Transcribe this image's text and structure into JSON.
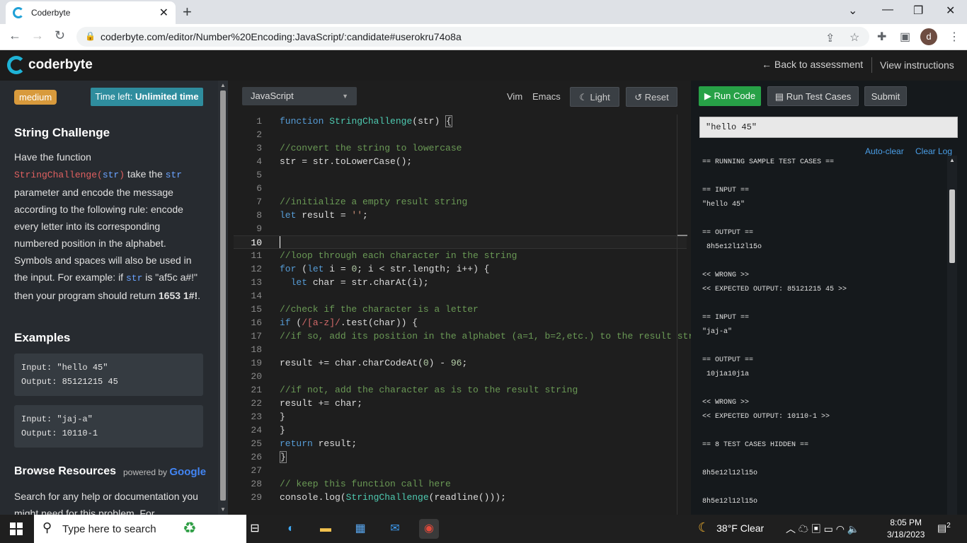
{
  "browser": {
    "tab_title": "Coderbyte",
    "url": "coderbyte.com/editor/Number%20Encoding:JavaScript/:candidate#userokru74o8a",
    "avatar_letter": "d"
  },
  "header": {
    "logo_text": "coderbyte",
    "back_link": "← Back to assessment",
    "view_instructions": "View instructions"
  },
  "left": {
    "difficulty": "medium",
    "time_left_label": "Time left:",
    "time_left_value": "Unlimited time",
    "title": "String Challenge",
    "desc_1": "Have the function",
    "desc_fn": "StringChallenge(",
    "desc_fn_arg": "str",
    "desc_fn_close": ")",
    "desc_2": " take the ",
    "desc_arg": "str",
    "desc_3": " parameter and encode the message according to the following rule: encode every letter into its corresponding numbered position in the alphabet. Symbols and spaces will also be used in the input. For example: if ",
    "desc_arg2": "str",
    "desc_4": " is \"af5c a#!\" then your program should return ",
    "desc_bold": "1653 1#!",
    "desc_5": ".",
    "examples_heading": "Examples",
    "examples": [
      {
        "input": "Input: \"hello 45\"",
        "output": "Output: 85121215 45"
      },
      {
        "input": "Input: \"jaj-a\"",
        "output": "Output: 10110-1"
      }
    ],
    "browse_heading": "Browse Resources",
    "powered_by": "powered by",
    "google": "Google",
    "browse_text": "Search for any help or documentation you might need for this problem. For"
  },
  "editor": {
    "language": "JavaScript",
    "vim": "Vim",
    "emacs": "Emacs",
    "light": "Light",
    "reset": "Reset",
    "current_line": 10
  },
  "right": {
    "run_code": "Run Code",
    "run_test_cases": "Run Test Cases",
    "submit": "Submit",
    "input_value": "\"hello 45\"",
    "auto_clear": "Auto-clear",
    "clear_log": "Clear Log",
    "log": [
      "== RUNNING SAMPLE TEST CASES ==",
      "",
      "== INPUT ==",
      "\"hello 45\"",
      "",
      "== OUTPUT ==",
      " 8h5e12l12l15o",
      "",
      "<< WRONG >>",
      "<< EXPECTED OUTPUT: 85121215 45 >>",
      "",
      "== INPUT ==",
      "\"jaj-a\"",
      "",
      "== OUTPUT ==",
      " 10j1a10j1a",
      "",
      "<< WRONG >>",
      "<< EXPECTED OUTPUT: 10110-1 >>",
      "",
      "== 8 TEST CASES HIDDEN ==",
      "",
      "8h5e12l12l15o",
      "",
      "8h5e12l12l15o"
    ]
  },
  "taskbar": {
    "search_placeholder": "Type here to search",
    "weather": "38°F  Clear",
    "time": "8:05 PM",
    "date": "3/18/2023",
    "notifications": "2"
  }
}
